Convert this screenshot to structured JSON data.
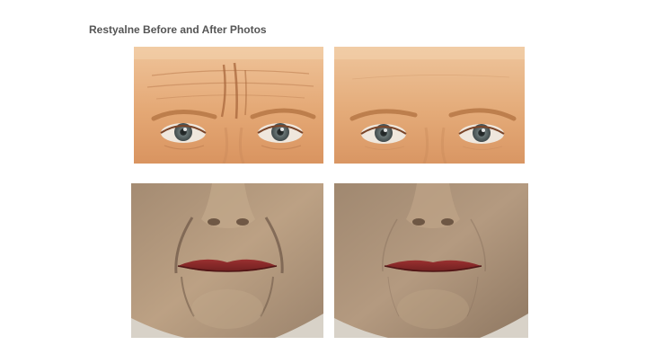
{
  "article": {
    "title": "Restyalne Before and After Photos"
  },
  "photos": [
    {
      "name": "forehead-before-photo",
      "region": "forehead and eyes",
      "state": "before"
    },
    {
      "name": "forehead-after-photo",
      "region": "forehead and eyes",
      "state": "after"
    },
    {
      "name": "mouth-before-photo",
      "region": "nose, mouth and chin",
      "state": "before"
    },
    {
      "name": "mouth-after-photo",
      "region": "nose, mouth and chin",
      "state": "after"
    }
  ],
  "colors": {
    "title": "#555555",
    "background": "#ffffff",
    "skin_warm": "#e7b07f",
    "skin_neutral": "#b79a80",
    "lips": "#8e2b2b",
    "iris": "#4f5a5c"
  }
}
